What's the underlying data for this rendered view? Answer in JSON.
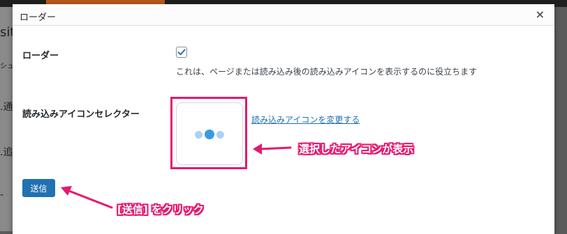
{
  "modal": {
    "title": "ローダー",
    "close_glyph": "×"
  },
  "loader": {
    "label": "ローダー",
    "checked": true,
    "description": "これは、ページまたは読み込み後の読み込みアイコンを表示するのに役立ちます"
  },
  "icon_selector": {
    "label": "読み込みアイコンセレクター",
    "change_link": "読み込みアイコンを変更する",
    "dot_colors": [
      "#a9d3f2",
      "#3a9be0",
      "#a9d3f2"
    ]
  },
  "submit_button": {
    "label": "送信"
  },
  "annotations": {
    "icon_shown": "選択したアイコンが表示",
    "click_submit": "[送信] をクリック",
    "accent_color": "#e6196e"
  },
  "background_page": {
    "side_fragments": [
      "sit",
      "シュ",
      ".通",
      ".追",
      "-"
    ]
  }
}
